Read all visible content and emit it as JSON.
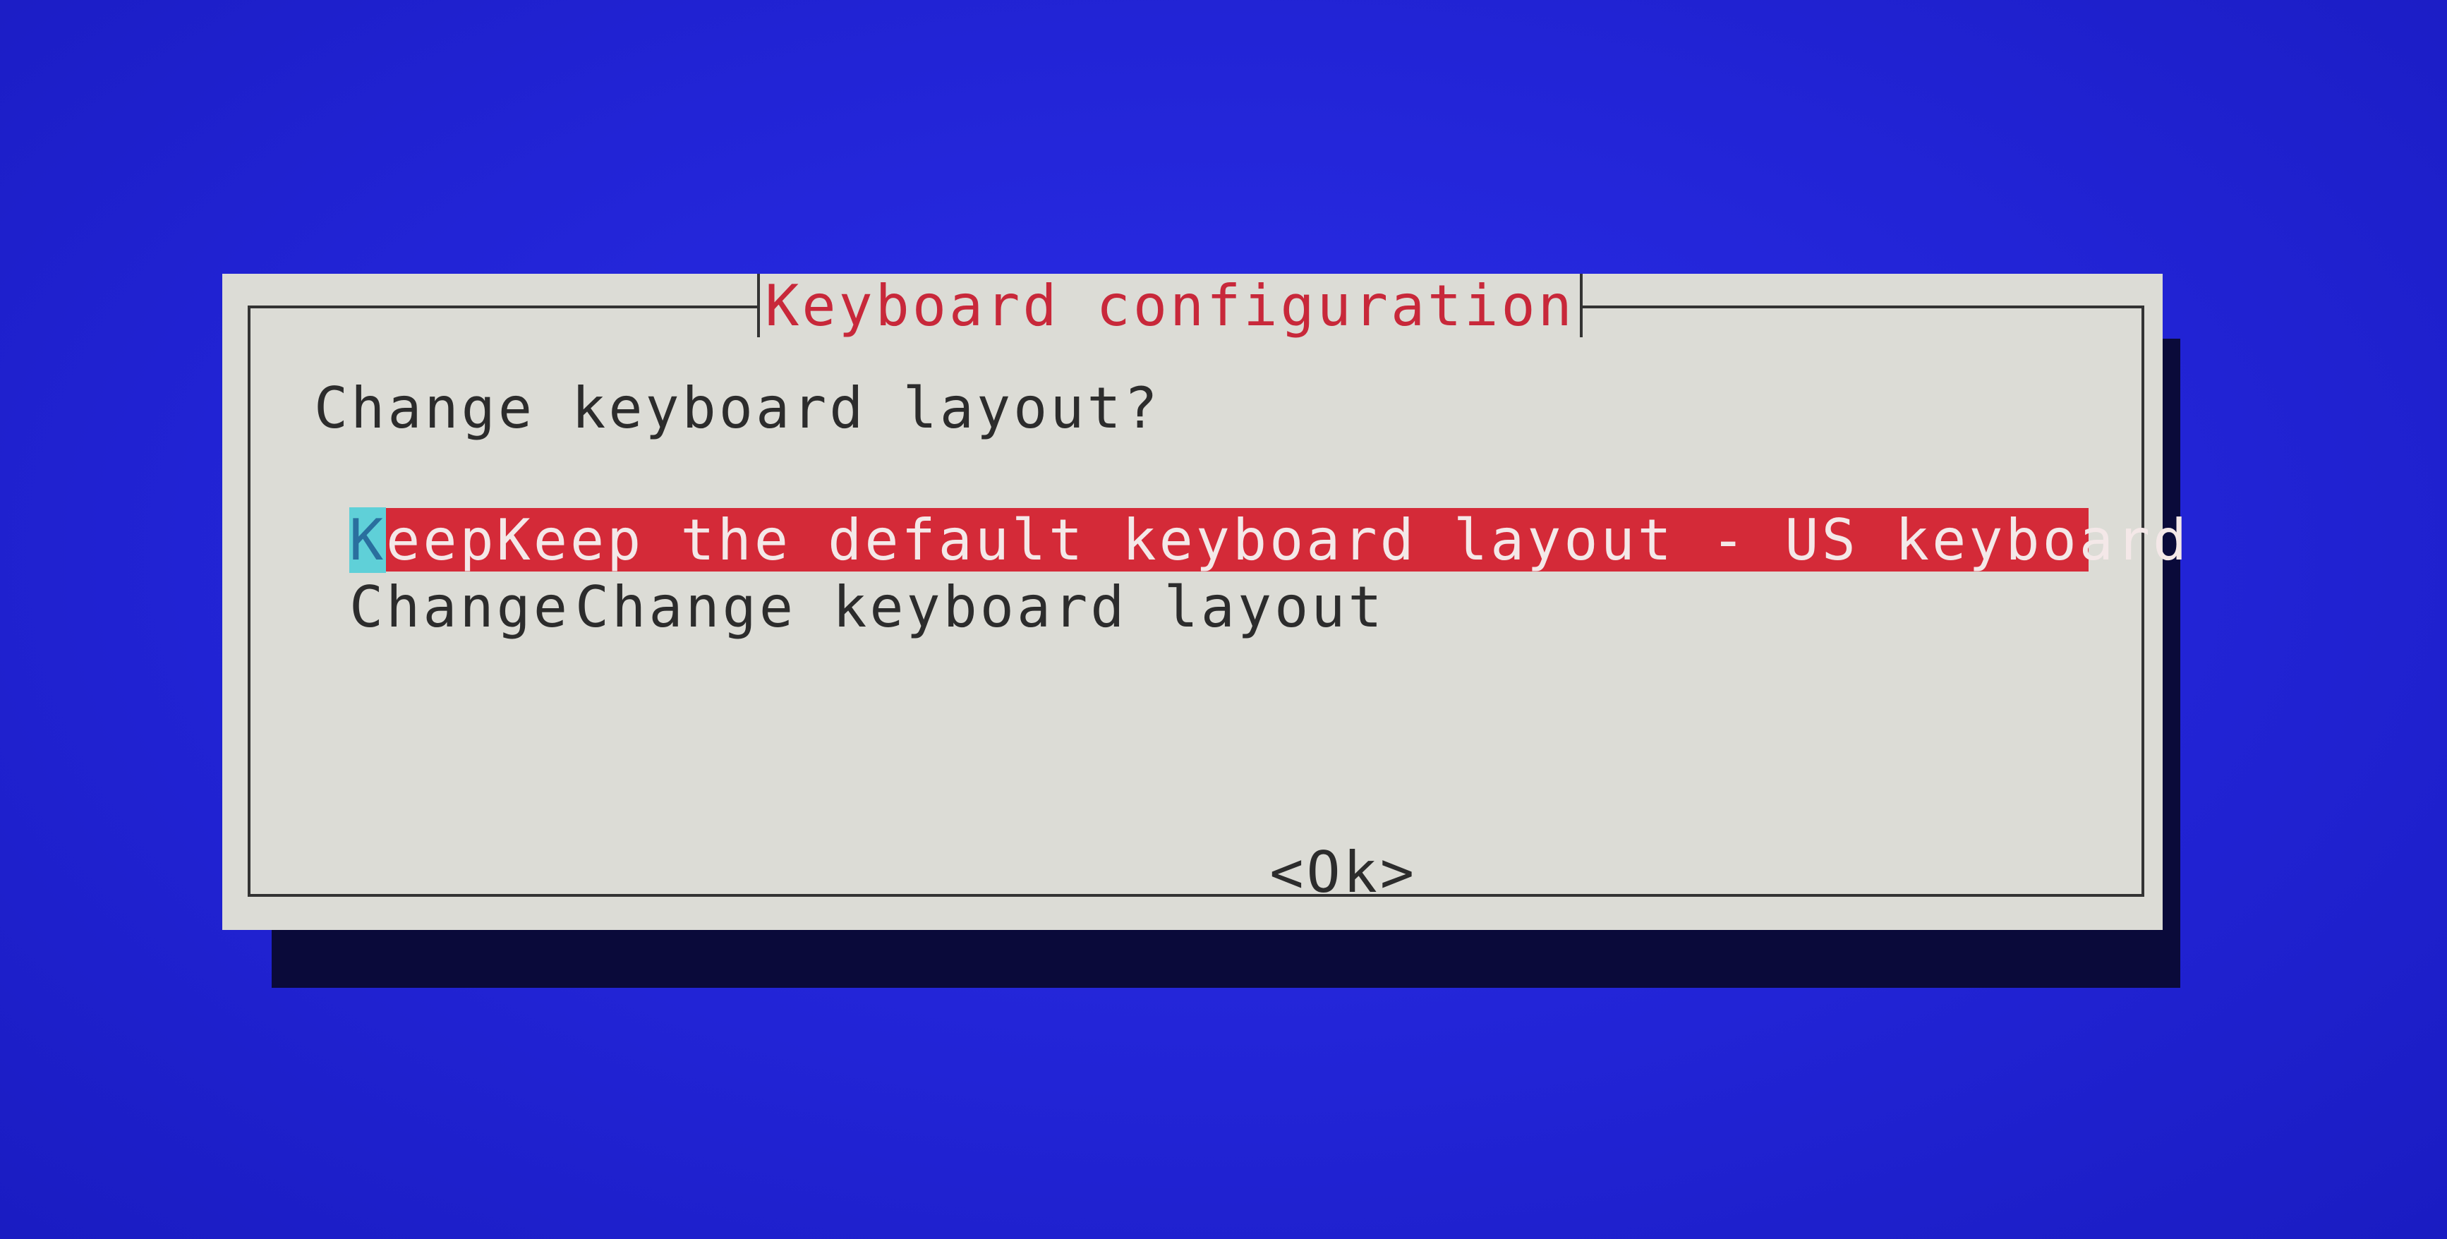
{
  "dialog": {
    "title": "Keyboard configuration",
    "question": "Change keyboard layout?",
    "options": [
      {
        "tag_first": "K",
        "tag_rest": "eep",
        "description": "Keep the default keyboard layout - US keyboard"
      },
      {
        "tag": "Change",
        "description": "Change keyboard layout"
      }
    ],
    "ok_label": "<Ok>"
  },
  "colors": {
    "background": "#2224d6",
    "dialog": "#dcdcd6",
    "title": "#c8283a",
    "highlight": "#d42a38",
    "cursor": "#5fd0d8"
  }
}
